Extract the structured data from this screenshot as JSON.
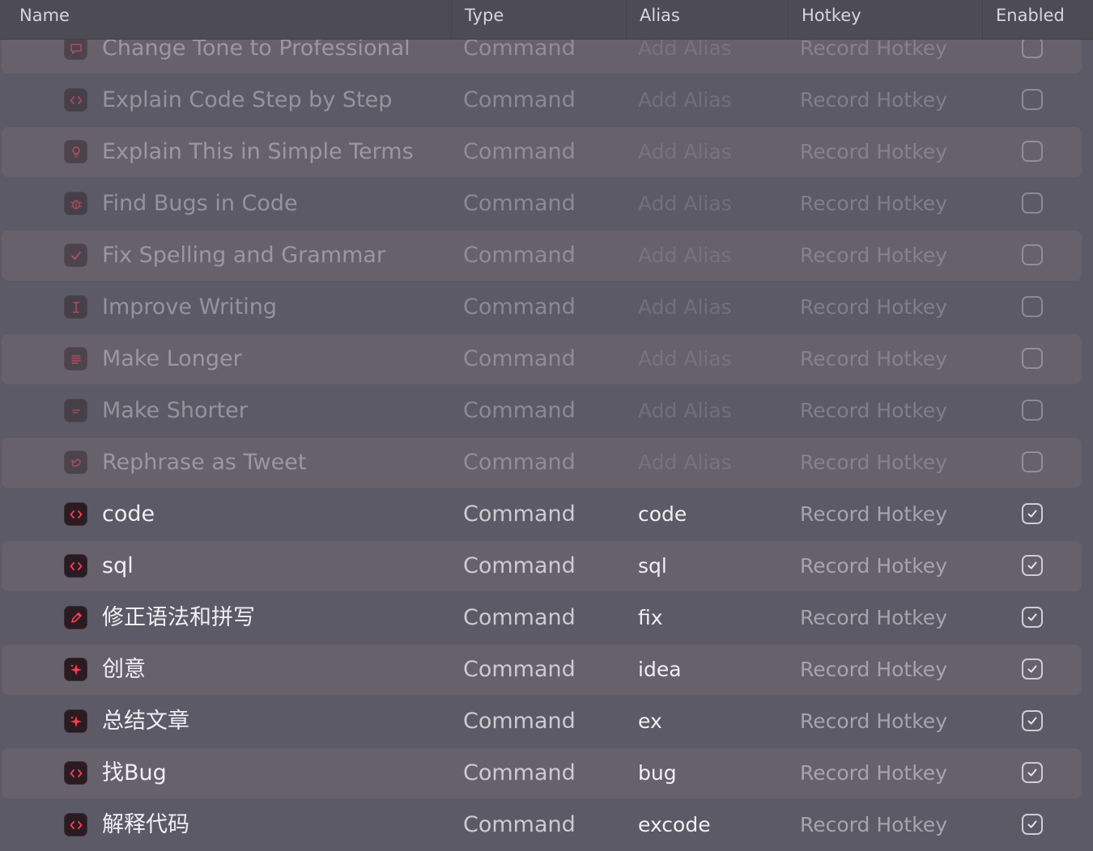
{
  "header": {
    "name": "Name",
    "type": "Type",
    "alias": "Alias",
    "hotkey": "Hotkey",
    "enabled": "Enabled"
  },
  "colors": {
    "icon_accent": "#ff3b4e",
    "background": "#5b5a66",
    "header_bg": "#4d4c55"
  },
  "rows": [
    {
      "name": "Change Tone to Professional",
      "type": "Command",
      "alias": "Add Alias",
      "hotkey": "Record Hotkey",
      "enabled": false,
      "icon": "speech-bubble-icon"
    },
    {
      "name": "Explain Code Step by Step",
      "type": "Command",
      "alias": "Add Alias",
      "hotkey": "Record Hotkey",
      "enabled": false,
      "icon": "code-brackets-icon"
    },
    {
      "name": "Explain This in Simple Terms",
      "type": "Command",
      "alias": "Add Alias",
      "hotkey": "Record Hotkey",
      "enabled": false,
      "icon": "lightbulb-icon"
    },
    {
      "name": "Find Bugs in Code",
      "type": "Command",
      "alias": "Add Alias",
      "hotkey": "Record Hotkey",
      "enabled": false,
      "icon": "bug-icon"
    },
    {
      "name": "Fix Spelling and Grammar",
      "type": "Command",
      "alias": "Add Alias",
      "hotkey": "Record Hotkey",
      "enabled": false,
      "icon": "checkmark-icon"
    },
    {
      "name": "Improve Writing",
      "type": "Command",
      "alias": "Add Alias",
      "hotkey": "Record Hotkey",
      "enabled": false,
      "icon": "text-cursor-icon"
    },
    {
      "name": "Make Longer",
      "type": "Command",
      "alias": "Add Alias",
      "hotkey": "Record Hotkey",
      "enabled": false,
      "icon": "text-lines-icon"
    },
    {
      "name": "Make Shorter",
      "type": "Command",
      "alias": "Add Alias",
      "hotkey": "Record Hotkey",
      "enabled": false,
      "icon": "short-lines-icon"
    },
    {
      "name": "Rephrase as Tweet",
      "type": "Command",
      "alias": "Add Alias",
      "hotkey": "Record Hotkey",
      "enabled": false,
      "icon": "bird-icon"
    },
    {
      "name": "code",
      "type": "Command",
      "alias": "code",
      "hotkey": "Record Hotkey",
      "enabled": true,
      "icon": "code-brackets-icon"
    },
    {
      "name": "sql",
      "type": "Command",
      "alias": "sql",
      "hotkey": "Record Hotkey",
      "enabled": true,
      "icon": "code-brackets-icon"
    },
    {
      "name": "修正语法和拼写",
      "type": "Command",
      "alias": "fix",
      "hotkey": "Record Hotkey",
      "enabled": true,
      "icon": "pencil-icon"
    },
    {
      "name": "创意",
      "type": "Command",
      "alias": "idea",
      "hotkey": "Record Hotkey",
      "enabled": true,
      "icon": "sparkle-icon"
    },
    {
      "name": "总结文章",
      "type": "Command",
      "alias": "ex",
      "hotkey": "Record Hotkey",
      "enabled": true,
      "icon": "sparkle-icon"
    },
    {
      "name": "找Bug",
      "type": "Command",
      "alias": "bug",
      "hotkey": "Record Hotkey",
      "enabled": true,
      "icon": "code-brackets-icon"
    },
    {
      "name": "解释代码",
      "type": "Command",
      "alias": "excode",
      "hotkey": "Record Hotkey",
      "enabled": true,
      "icon": "code-brackets-icon"
    }
  ]
}
